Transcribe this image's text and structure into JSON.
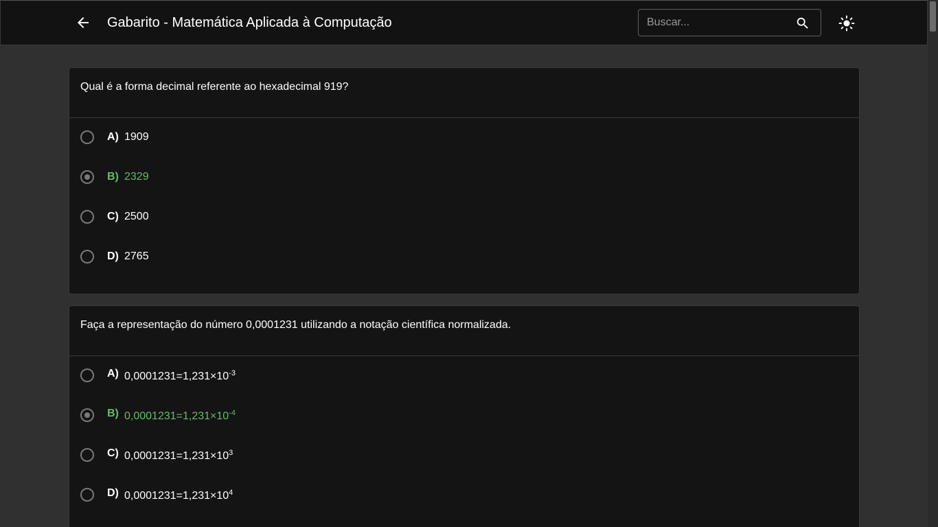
{
  "header": {
    "title": "Gabarito - Matemática Aplicada à Computação",
    "search_placeholder": "Buscar...",
    "back_icon": "arrow-left-icon",
    "search_icon": "search-icon",
    "theme_icon": "sun-icon"
  },
  "colors": {
    "background": "#303030",
    "surface": "#141414",
    "correct": "#66bb6a"
  },
  "questions": [
    {
      "text": "Qual é a forma decimal referente ao hexadecimal 919?",
      "options": [
        {
          "letter": "A)",
          "text": "1909",
          "selected": false,
          "correct": false
        },
        {
          "letter": "B)",
          "text": "2329",
          "selected": true,
          "correct": true
        },
        {
          "letter": "C)",
          "text": "2500",
          "selected": false,
          "correct": false
        },
        {
          "letter": "D)",
          "text": "2765",
          "selected": false,
          "correct": false
        }
      ]
    },
    {
      "text": "Faça a representação do número 0,0001231 utilizando a notação científica normalizada.",
      "options": [
        {
          "letter": "A)",
          "base": "0,0001231=1,231×10",
          "exp": "-3",
          "selected": false,
          "correct": false
        },
        {
          "letter": "B)",
          "base": "0,0001231=1,231×10",
          "exp": "-4",
          "selected": true,
          "correct": true
        },
        {
          "letter": "C)",
          "base": "0,0001231=1,231×10",
          "exp": "3",
          "selected": false,
          "correct": false
        },
        {
          "letter": "D)",
          "base": "0,0001231=1,231×10",
          "exp": "4",
          "selected": false,
          "correct": false
        }
      ]
    }
  ]
}
